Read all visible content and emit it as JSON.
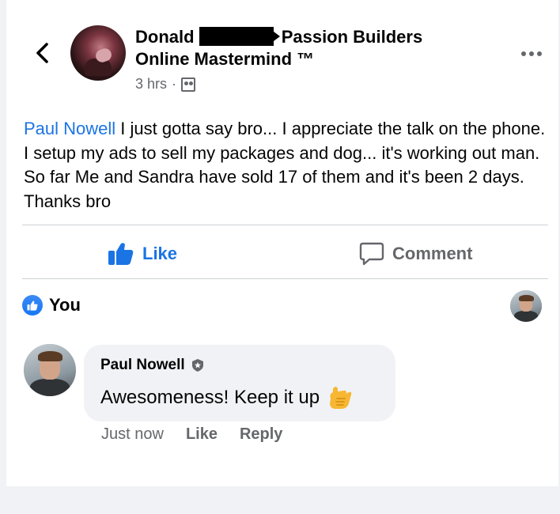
{
  "post": {
    "author_first": "Donald",
    "group_name_line1": "Passion Builders",
    "group_name_line2": "Online Mastermind ™",
    "time": "3 hrs",
    "separator": "·",
    "group_icon": "group-privacy-icon",
    "mention": "Paul Nowell",
    "body": " I just gotta say bro... I appreciate the talk on the phone.  I setup my ads to sell my packages and dog... it's working out man.  So far Me and Sandra have sold 17 of them and it's been 2 days.  Thanks bro"
  },
  "actions": {
    "like_label": "Like",
    "comment_label": "Comment"
  },
  "reactions": {
    "label": "You"
  },
  "comment": {
    "author": "Paul Nowell",
    "text": "Awesomeness! Keep it up",
    "emoji": "call-me-hand-emoji",
    "time": "Just now",
    "like_label": "Like",
    "reply_label": "Reply"
  },
  "colors": {
    "accent": "#1b74e4",
    "secondary_text": "#65676b",
    "bubble": "#f0f2f5"
  }
}
